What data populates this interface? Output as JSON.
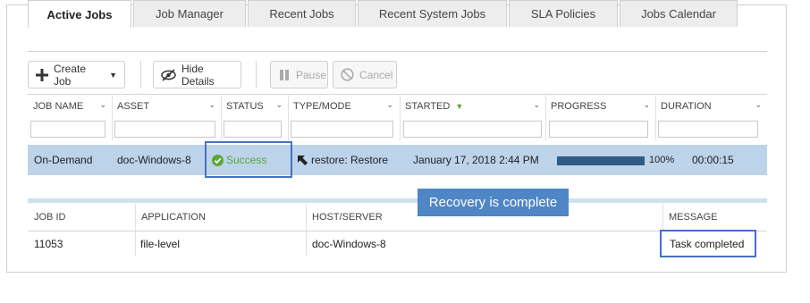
{
  "tabs": [
    {
      "label": "Active Jobs",
      "active": true
    },
    {
      "label": "Job Manager"
    },
    {
      "label": "Recent Jobs"
    },
    {
      "label": "Recent System Jobs"
    },
    {
      "label": "SLA Policies"
    },
    {
      "label": "Jobs Calendar"
    }
  ],
  "toolbar": {
    "create_job": "Create Job",
    "hide_details": "Hide Details",
    "pause": "Pause",
    "cancel": "Cancel"
  },
  "jobs_table": {
    "columns": [
      "JOB NAME",
      "ASSET",
      "STATUS",
      "TYPE/MODE",
      "STARTED",
      "PROGRESS",
      "DURATION"
    ],
    "sorted_column": "STARTED",
    "row": {
      "job_name": "On-Demand",
      "asset": "doc-Windows-8",
      "status": "Success",
      "type_mode": "restore: Restore",
      "started": "January 17, 2018 2:44 PM",
      "progress": "100%",
      "progress_value": 100,
      "duration": "00:00:15"
    }
  },
  "details": {
    "columns": [
      "JOB ID",
      "APPLICATION",
      "HOST/SERVER",
      "MESSAGE"
    ],
    "row": {
      "job_id": "11053",
      "application": "file-level",
      "host_server": "doc-Windows-8",
      "message": "Task completed"
    }
  },
  "tooltip": "Recovery is complete",
  "colors": {
    "accent": "#4472c4",
    "selected_row": "#bcd3ea",
    "success": "#59a838",
    "progress": "#2f5b86",
    "tooltip_bg": "#4f86c6"
  }
}
